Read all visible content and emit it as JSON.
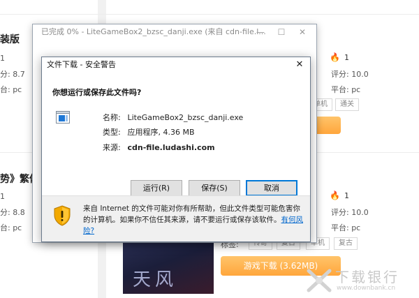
{
  "background": {
    "left_col": {
      "title1": "装版",
      "count1": "1",
      "rating1": "分: 8.7",
      "platform1": "台: pc",
      "title2": "势》繁体",
      "count2": "1",
      "rating2": "分: 8.8",
      "platform2": "台: pc"
    },
    "right_col": {
      "count1": "1",
      "rating1": "评分: 10.0",
      "platform1": "平台: pc",
      "tags1": [
        "单机",
        "通关"
      ],
      "count2": "1",
      "rating2": "评分: 10.0",
      "platform2": "平台: pc",
      "tag_label2": "标签:",
      "tags2": [
        "传奇",
        "复古",
        "单机",
        "复古"
      ],
      "download_button": "游戏下载 (3.62MB)"
    }
  },
  "progress_window": {
    "title": "已完成 0% - LiteGameBox2_bzsc_danji.exe (来自 cdn-file.l...",
    "minimize": "—",
    "maximize": "☐",
    "close": "✕"
  },
  "dialog": {
    "title": "文件下载 - 安全警告",
    "close": "✕",
    "question": "你想运行或保存此文件吗?",
    "name_label": "名称:",
    "name_value": "LiteGameBox2_bzsc_danji.exe",
    "type_label": "类型:",
    "type_value": "应用程序, 4.36 MB",
    "source_label": "来源:",
    "source_value": "cdn-file.ludashi.com",
    "run_button": "运行(R)",
    "save_button": "保存(S)",
    "cancel_button": "取消",
    "warning_text": "来自 Internet 的文件可能对你有所帮助，但此文件类型可能危害你的计算机。如果你不信任其来源，请不要运行或保存该软件。",
    "warning_link": "有何风险?"
  },
  "watermark": {
    "name": "下载银行",
    "url": "www.downbank.cn"
  },
  "colors": {
    "accent_blue": "#0078d7",
    "orange_button": "#ffa63c",
    "link_blue": "#0066cc",
    "fire_red": "#ff4b2b"
  }
}
